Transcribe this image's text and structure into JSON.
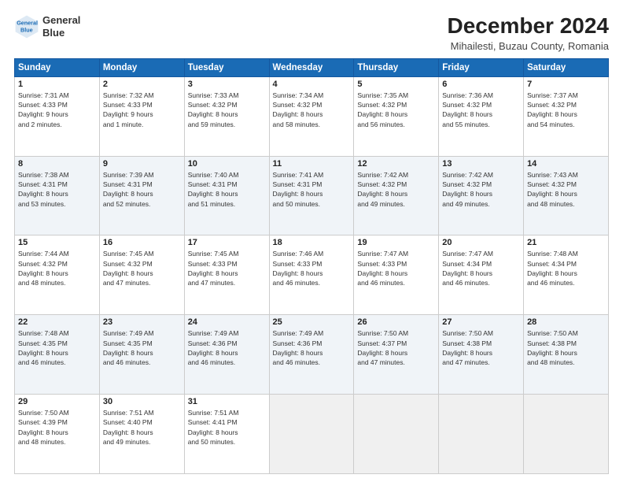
{
  "header": {
    "logo_line1": "General",
    "logo_line2": "Blue",
    "title": "December 2024",
    "subtitle": "Mihailesti, Buzau County, Romania"
  },
  "days_of_week": [
    "Sunday",
    "Monday",
    "Tuesday",
    "Wednesday",
    "Thursday",
    "Friday",
    "Saturday"
  ],
  "weeks": [
    [
      {
        "day": "1",
        "info": "Sunrise: 7:31 AM\nSunset: 4:33 PM\nDaylight: 9 hours\nand 2 minutes."
      },
      {
        "day": "2",
        "info": "Sunrise: 7:32 AM\nSunset: 4:33 PM\nDaylight: 9 hours\nand 1 minute."
      },
      {
        "day": "3",
        "info": "Sunrise: 7:33 AM\nSunset: 4:32 PM\nDaylight: 8 hours\nand 59 minutes."
      },
      {
        "day": "4",
        "info": "Sunrise: 7:34 AM\nSunset: 4:32 PM\nDaylight: 8 hours\nand 58 minutes."
      },
      {
        "day": "5",
        "info": "Sunrise: 7:35 AM\nSunset: 4:32 PM\nDaylight: 8 hours\nand 56 minutes."
      },
      {
        "day": "6",
        "info": "Sunrise: 7:36 AM\nSunset: 4:32 PM\nDaylight: 8 hours\nand 55 minutes."
      },
      {
        "day": "7",
        "info": "Sunrise: 7:37 AM\nSunset: 4:32 PM\nDaylight: 8 hours\nand 54 minutes."
      }
    ],
    [
      {
        "day": "8",
        "info": "Sunrise: 7:38 AM\nSunset: 4:31 PM\nDaylight: 8 hours\nand 53 minutes."
      },
      {
        "day": "9",
        "info": "Sunrise: 7:39 AM\nSunset: 4:31 PM\nDaylight: 8 hours\nand 52 minutes."
      },
      {
        "day": "10",
        "info": "Sunrise: 7:40 AM\nSunset: 4:31 PM\nDaylight: 8 hours\nand 51 minutes."
      },
      {
        "day": "11",
        "info": "Sunrise: 7:41 AM\nSunset: 4:31 PM\nDaylight: 8 hours\nand 50 minutes."
      },
      {
        "day": "12",
        "info": "Sunrise: 7:42 AM\nSunset: 4:32 PM\nDaylight: 8 hours\nand 49 minutes."
      },
      {
        "day": "13",
        "info": "Sunrise: 7:42 AM\nSunset: 4:32 PM\nDaylight: 8 hours\nand 49 minutes."
      },
      {
        "day": "14",
        "info": "Sunrise: 7:43 AM\nSunset: 4:32 PM\nDaylight: 8 hours\nand 48 minutes."
      }
    ],
    [
      {
        "day": "15",
        "info": "Sunrise: 7:44 AM\nSunset: 4:32 PM\nDaylight: 8 hours\nand 48 minutes."
      },
      {
        "day": "16",
        "info": "Sunrise: 7:45 AM\nSunset: 4:32 PM\nDaylight: 8 hours\nand 47 minutes."
      },
      {
        "day": "17",
        "info": "Sunrise: 7:45 AM\nSunset: 4:33 PM\nDaylight: 8 hours\nand 47 minutes."
      },
      {
        "day": "18",
        "info": "Sunrise: 7:46 AM\nSunset: 4:33 PM\nDaylight: 8 hours\nand 46 minutes."
      },
      {
        "day": "19",
        "info": "Sunrise: 7:47 AM\nSunset: 4:33 PM\nDaylight: 8 hours\nand 46 minutes."
      },
      {
        "day": "20",
        "info": "Sunrise: 7:47 AM\nSunset: 4:34 PM\nDaylight: 8 hours\nand 46 minutes."
      },
      {
        "day": "21",
        "info": "Sunrise: 7:48 AM\nSunset: 4:34 PM\nDaylight: 8 hours\nand 46 minutes."
      }
    ],
    [
      {
        "day": "22",
        "info": "Sunrise: 7:48 AM\nSunset: 4:35 PM\nDaylight: 8 hours\nand 46 minutes."
      },
      {
        "day": "23",
        "info": "Sunrise: 7:49 AM\nSunset: 4:35 PM\nDaylight: 8 hours\nand 46 minutes."
      },
      {
        "day": "24",
        "info": "Sunrise: 7:49 AM\nSunset: 4:36 PM\nDaylight: 8 hours\nand 46 minutes."
      },
      {
        "day": "25",
        "info": "Sunrise: 7:49 AM\nSunset: 4:36 PM\nDaylight: 8 hours\nand 46 minutes."
      },
      {
        "day": "26",
        "info": "Sunrise: 7:50 AM\nSunset: 4:37 PM\nDaylight: 8 hours\nand 47 minutes."
      },
      {
        "day": "27",
        "info": "Sunrise: 7:50 AM\nSunset: 4:38 PM\nDaylight: 8 hours\nand 47 minutes."
      },
      {
        "day": "28",
        "info": "Sunrise: 7:50 AM\nSunset: 4:38 PM\nDaylight: 8 hours\nand 48 minutes."
      }
    ],
    [
      {
        "day": "29",
        "info": "Sunrise: 7:50 AM\nSunset: 4:39 PM\nDaylight: 8 hours\nand 48 minutes."
      },
      {
        "day": "30",
        "info": "Sunrise: 7:51 AM\nSunset: 4:40 PM\nDaylight: 8 hours\nand 49 minutes."
      },
      {
        "day": "31",
        "info": "Sunrise: 7:51 AM\nSunset: 4:41 PM\nDaylight: 8 hours\nand 50 minutes."
      },
      {
        "day": "",
        "info": ""
      },
      {
        "day": "",
        "info": ""
      },
      {
        "day": "",
        "info": ""
      },
      {
        "day": "",
        "info": ""
      }
    ]
  ]
}
